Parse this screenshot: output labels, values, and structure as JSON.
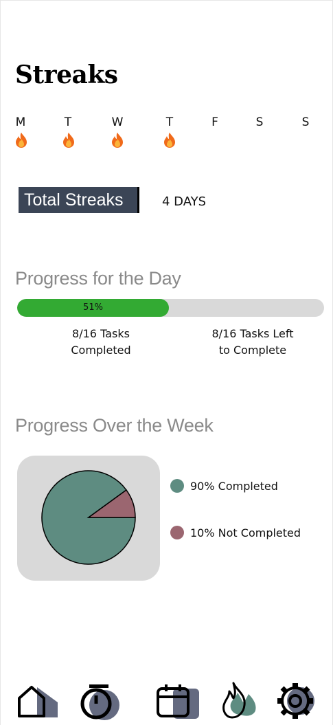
{
  "page": {
    "title": "Streaks"
  },
  "week": {
    "days": [
      {
        "label": "M",
        "has_streak": true
      },
      {
        "label": "T",
        "has_streak": true
      },
      {
        "label": "W",
        "has_streak": true
      },
      {
        "label": "T",
        "has_streak": true
      },
      {
        "label": "F",
        "has_streak": false
      },
      {
        "label": "S",
        "has_streak": false
      },
      {
        "label": "S",
        "has_streak": false
      }
    ],
    "streak_icon": "fire-icon"
  },
  "total_streaks": {
    "label": "Total Streaks",
    "value": "4 DAYS"
  },
  "day_progress": {
    "title": "Progress for the Day",
    "percent_label": "51%",
    "fraction": 0.51,
    "completed_line1": "8/16 Tasks",
    "completed_line2": "Completed",
    "remaining_line1": "8/16 Tasks Left",
    "remaining_line2": "to Complete",
    "fill_color": "#33aa33",
    "track_color": "#d9d9d9"
  },
  "week_progress": {
    "title": "Progress Over the Week",
    "legend": [
      {
        "label": "90% Completed",
        "color": "#5e8c81"
      },
      {
        "label": "10% Not Completed",
        "color": "#9b6670"
      }
    ]
  },
  "chart_data": {
    "type": "pie",
    "categories": [
      "Completed",
      "Not Completed"
    ],
    "values": [
      90,
      10
    ],
    "colors": [
      "#5e8c81",
      "#9b6670"
    ]
  },
  "nav": {
    "items": [
      {
        "name": "home",
        "icon": "home-icon"
      },
      {
        "name": "timer",
        "icon": "stopwatch-icon"
      },
      {
        "name": "calendar",
        "icon": "calendar-icon"
      },
      {
        "name": "streaks",
        "icon": "fire-icon"
      },
      {
        "name": "settings",
        "icon": "gear-icon"
      }
    ]
  }
}
